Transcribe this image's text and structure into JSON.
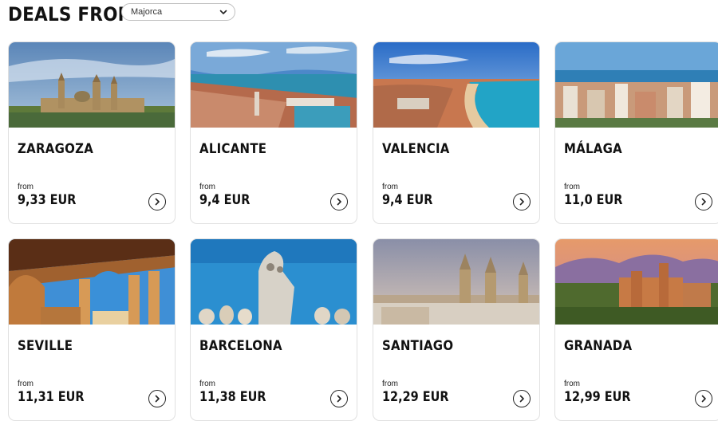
{
  "header": {
    "title": "DEALS FROM",
    "origin_select": {
      "value": "Majorca",
      "icon": "chevron-down-icon"
    }
  },
  "deals": [
    {
      "city": "ZARAGOZA",
      "from_label": "from",
      "price": "9,33 EUR",
      "icon": "chevron-right-circle-icon"
    },
    {
      "city": "ALICANTE",
      "from_label": "from",
      "price": "9,4 EUR",
      "icon": "chevron-right-circle-icon"
    },
    {
      "city": "VALENCIA",
      "from_label": "from",
      "price": "9,4 EUR",
      "icon": "chevron-right-circle-icon"
    },
    {
      "city": "MÁLAGA",
      "from_label": "from",
      "price": "11,0 EUR",
      "icon": "chevron-right-circle-icon"
    },
    {
      "city": "SEVILLE",
      "from_label": "from",
      "price": "11,31 EUR",
      "icon": "chevron-right-circle-icon"
    },
    {
      "city": "BARCELONA",
      "from_label": "from",
      "price": "11,38 EUR",
      "icon": "chevron-right-circle-icon"
    },
    {
      "city": "SANTIAGO",
      "from_label": "from",
      "price": "12,29 EUR",
      "icon": "chevron-right-circle-icon"
    },
    {
      "city": "GRANADA",
      "from_label": "from",
      "price": "12,99 EUR",
      "icon": "chevron-right-circle-icon"
    }
  ]
}
